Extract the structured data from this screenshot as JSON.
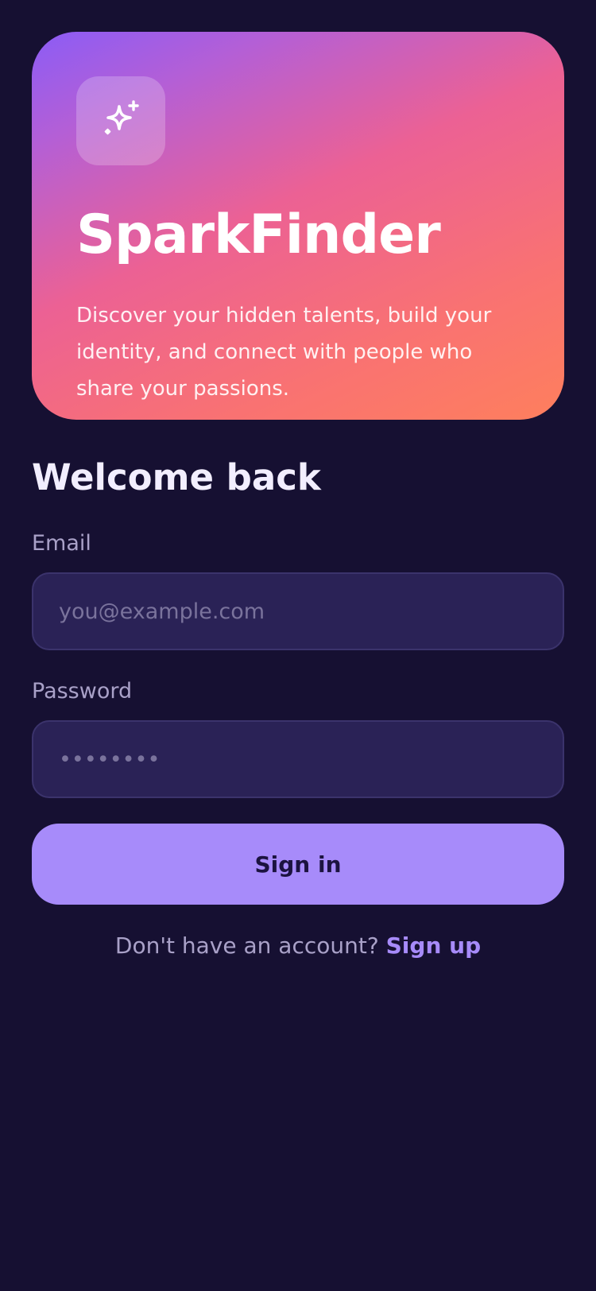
{
  "hero": {
    "icon": "sparkles-icon",
    "title": "SparkFinder",
    "description": "Discover your hidden talents, build your identity, and connect with people who share your passions."
  },
  "form": {
    "heading": "Welcome back",
    "email": {
      "label": "Email",
      "value": "",
      "placeholder": "you@example.com"
    },
    "password": {
      "label": "Password",
      "value": "",
      "placeholder": "••••••••"
    },
    "submit_label": "Sign in"
  },
  "footer": {
    "prompt": "Don't have an account?",
    "link_label": "Sign up"
  },
  "colors": {
    "background": "#161032",
    "accent": "#a78bfa",
    "input_background": "#2a2256",
    "gradient": [
      "#8b5cf6",
      "#ec6194",
      "#fe7f5d"
    ]
  }
}
